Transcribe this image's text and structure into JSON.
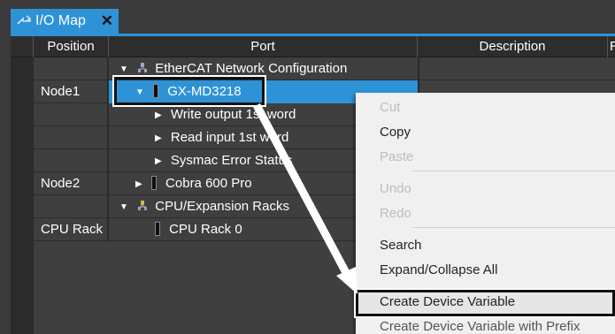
{
  "tab": {
    "title": "I/O Map",
    "close": "✕"
  },
  "columns": {
    "position": "Position",
    "port": "Port",
    "description": "Description",
    "extra": "R"
  },
  "rows": [
    {
      "position": "",
      "port": "EtherCAT Network Configuration"
    },
    {
      "position": "Node1",
      "port": "GX-MD3218"
    },
    {
      "position": "",
      "port": "Write output 1st word"
    },
    {
      "position": "",
      "port": "Read input 1st word"
    },
    {
      "position": "",
      "port": "Sysmac Error Status"
    },
    {
      "position": "Node2",
      "port": "Cobra 600 Pro"
    },
    {
      "position": "",
      "port": "CPU/Expansion Racks"
    },
    {
      "position": "CPU Rack",
      "port": "CPU Rack 0"
    }
  ],
  "context_menu": {
    "cut": "Cut",
    "copy": "Copy",
    "paste": "Paste",
    "undo": "Undo",
    "redo": "Redo",
    "search": "Search",
    "expand_collapse": "Expand/Collapse All",
    "create_device_variable": "Create Device Variable",
    "create_device_variable_prefix": "Create Device Variable with Prefix"
  },
  "colors": {
    "accent": "#2e93d6",
    "background": "#3f3f3f",
    "menu_bg": "#f0f0f0"
  }
}
